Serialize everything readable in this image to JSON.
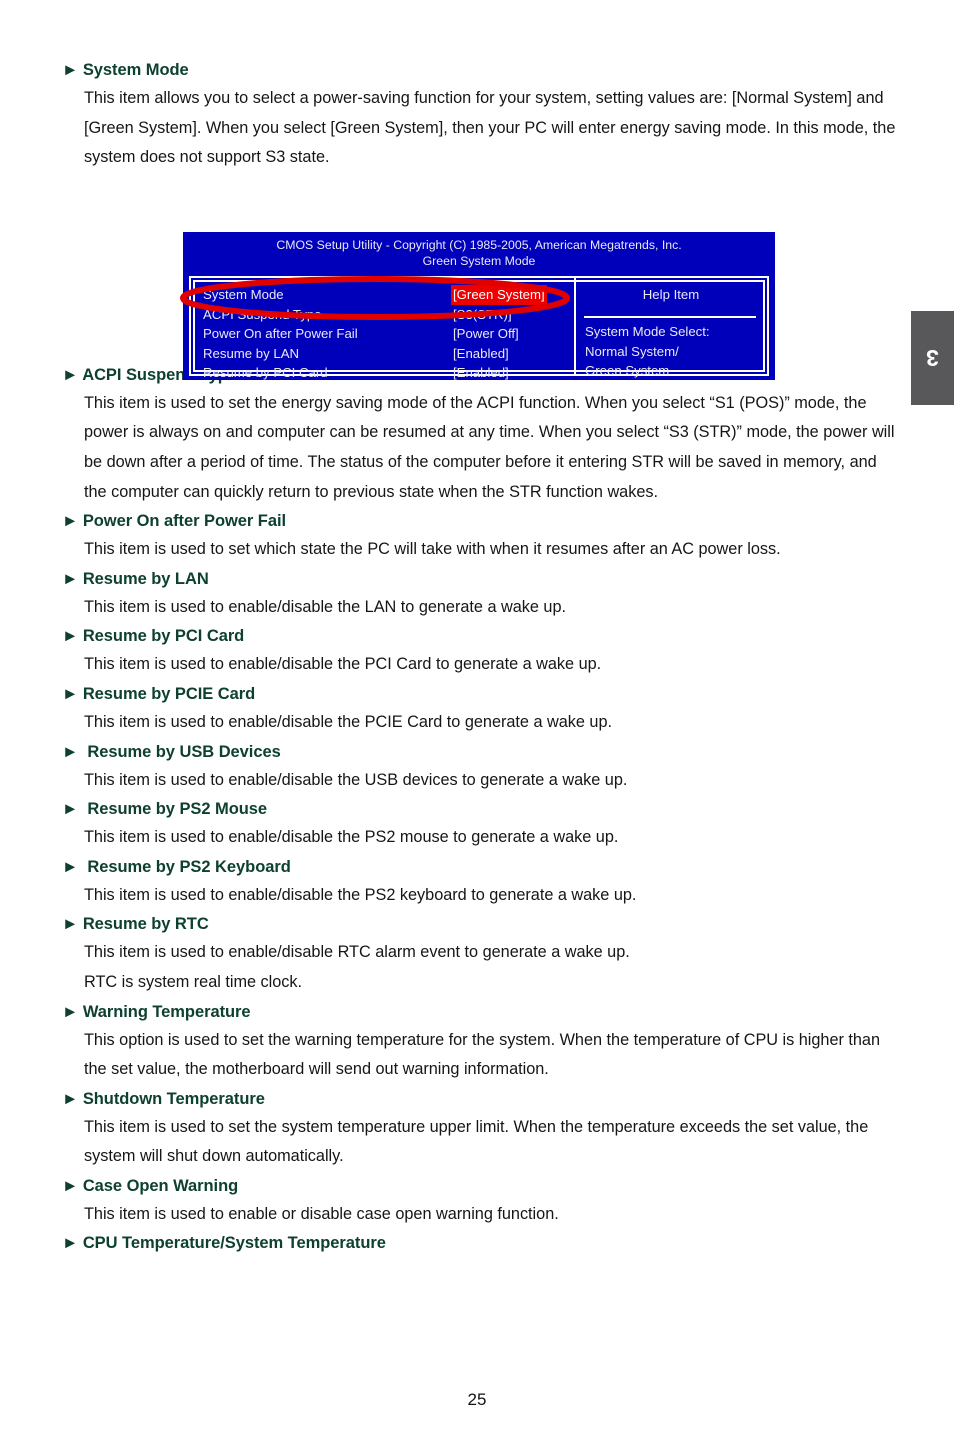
{
  "page": {
    "number": "25",
    "chapter_tab": "3"
  },
  "colors": {
    "heading_green": "#0e4032",
    "bios_background": "#0000bb",
    "bios_text": "#e9e9f6",
    "selection_red": "#ee0000",
    "annotation_red": "#e00000",
    "tab_gray": "#58585a"
  },
  "sections": [
    {
      "arrow": "►",
      "heading": "System Mode",
      "paragraphs": [
        "This item allows you to select a power-saving function for your system, setting values are: [Normal System] and [Green System]. When you select [Green System], then your PC will enter energy saving mode. In this mode, the system does not support S3 state."
      ]
    },
    {
      "arrow": "►",
      "heading": "ACPI Suspend Type",
      "paragraphs": [
        "This item is used to set the energy saving mode of the ACPI function. When you select “S1 (POS)” mode, the power is always on and computer can be resumed at any time. When you select “S3 (STR)” mode, the power will be down after a period of time. The status of the computer before it entering STR will be saved in memory, and the computer can quickly return to previous state when the STR function wakes."
      ]
    },
    {
      "arrow": "►",
      "heading": "Power On after Power Fail",
      "paragraphs": [
        "This item is used to set which state the PC will take with when it resumes after an AC power loss."
      ]
    },
    {
      "arrow": "►",
      "heading": "Resume by LAN",
      "paragraphs": [
        "This item is used to enable/disable the LAN to generate a wake up."
      ]
    },
    {
      "arrow": "►",
      "heading": "Resume by PCI Card",
      "paragraphs": [
        "This item is used to enable/disable the PCI Card to generate a wake up."
      ]
    },
    {
      "arrow": "►",
      "heading": "Resume by PCIE Card",
      "paragraphs": [
        "This item is used to enable/disable the PCIE Card to generate a wake up."
      ]
    },
    {
      "arrow": "►",
      "heading": " Resume by USB Devices",
      "paragraphs": [
        "This item is used to enable/disable the USB devices to generate a wake up."
      ]
    },
    {
      "arrow": "►",
      "heading": " Resume by PS2 Mouse",
      "paragraphs": [
        "This item is used to enable/disable the PS2 mouse to generate a wake up."
      ]
    },
    {
      "arrow": "►",
      "heading": " Resume by PS2 Keyboard",
      "paragraphs": [
        "This item is used to enable/disable the PS2 keyboard to generate a wake up."
      ]
    },
    {
      "arrow": "►",
      "heading": "Resume by RTC",
      "paragraphs": [
        "This item is used to enable/disable RTC alarm event to generate a wake up.",
        "RTC is system real time clock."
      ]
    },
    {
      "arrow": "►",
      "heading": "Warning Temperature",
      "paragraphs": [
        "This option is used to set the warning temperature for the system. When the temperature of CPU is higher than the set value, the motherboard will send out warning information."
      ]
    },
    {
      "arrow": "►",
      "heading": "Shutdown Temperature",
      "paragraphs": [
        "This item is used to set the system temperature upper limit. When the temperature exceeds the set value, the system will shut down automatically."
      ]
    },
    {
      "arrow": "►",
      "heading": "Case Open Warning",
      "paragraphs": [
        "This item is used to enable or disable case open warning function."
      ]
    },
    {
      "arrow": "►",
      "heading": "CPU Temperature/System Temperature",
      "paragraphs": []
    }
  ],
  "bios": {
    "title_line1": "CMOS Setup Utility - Copyright (C) 1985-2005, American Megatrends, Inc.",
    "title_line2": "Green System Mode",
    "rows": [
      {
        "label": "System Mode",
        "value": "[Green System]",
        "selected": true
      },
      {
        "label": "ACPI Suspend Type",
        "value": "[S3(STR)]",
        "selected": false
      },
      {
        "label": "Power On after Power Fail",
        "value": "[Power Off]",
        "selected": false
      },
      {
        "label": "Resume by LAN",
        "value": "[Enabled]",
        "selected": false
      },
      {
        "label": "Resume by PCI Card",
        "value": "[Enabled]",
        "selected": false
      }
    ],
    "help_title": "Help Item",
    "help_lines": [
      "System Mode Select:",
      "Normal System/",
      "Green System"
    ]
  }
}
